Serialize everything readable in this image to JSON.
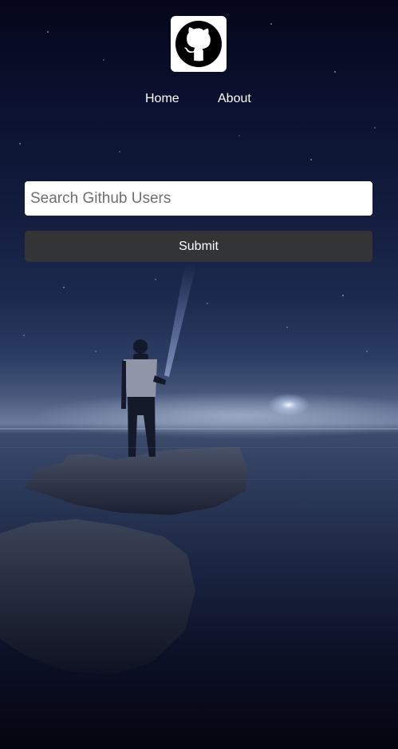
{
  "logo": {
    "icon": "github-octocat-icon",
    "alt": "GitHub"
  },
  "nav": {
    "home_label": "Home",
    "about_label": "About"
  },
  "search": {
    "placeholder": "Search Github Users",
    "value": ""
  },
  "submit": {
    "label": "Submit"
  },
  "colors": {
    "button_bg": "#333436",
    "logo_bg": "#ffffff",
    "nav_text": "#ffffff"
  }
}
